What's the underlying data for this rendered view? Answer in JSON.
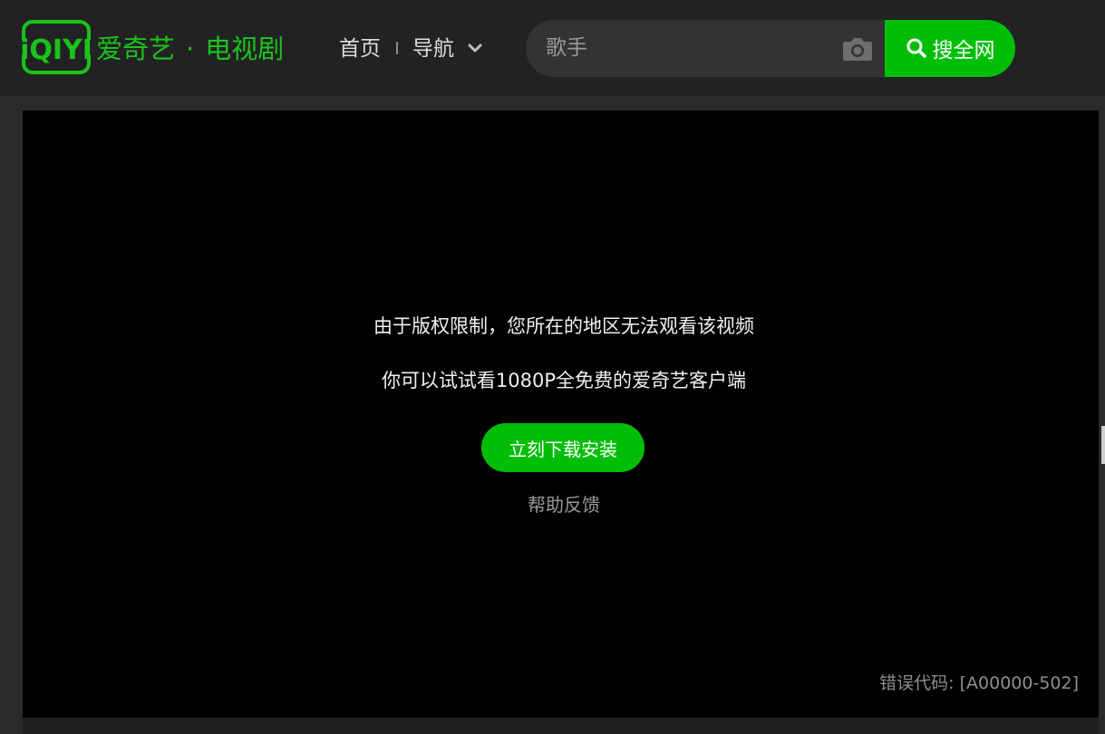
{
  "header": {
    "logo": "iQIYI",
    "brand": "爱奇艺",
    "brand_dot": "·",
    "channel": "电视剧",
    "nav_home": "首页",
    "nav_guide": "导航",
    "search_placeholder": "歌手",
    "search_button": "搜全网",
    "icons": {
      "camera": "camera-icon",
      "search": "search-icon",
      "chevron": "chevron-down-icon"
    }
  },
  "player": {
    "message_line1": "由于版权限制，您所在的地区无法观看该视频",
    "message_line2": "你可以试试看1080P全免费的爱奇艺客户端",
    "download_button": "立刻下载安装",
    "help_link": "帮助反馈",
    "error_code": "错误代码: [A00000-502]"
  },
  "colors": {
    "brand_green": "#1ac31a",
    "button_green": "#00be06",
    "header_bg": "#222224",
    "player_bg": "#000000"
  }
}
